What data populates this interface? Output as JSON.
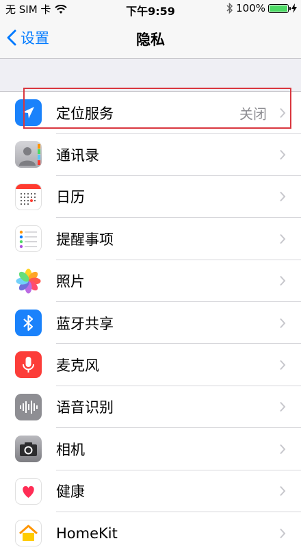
{
  "status_bar": {
    "carrier": "无 SIM 卡",
    "time": "下午9:59",
    "battery": "100%",
    "battery_level": 1.0
  },
  "nav": {
    "back_label": "设置",
    "title": "隐私"
  },
  "rows": [
    {
      "label": "定位服务",
      "value": "关闭",
      "icon": "location-arrow-icon",
      "color": "#1a82fb"
    },
    {
      "label": "通讯录",
      "value": "",
      "icon": "contacts-icon",
      "color": "#8e8e93"
    },
    {
      "label": "日历",
      "value": "",
      "icon": "calendar-icon",
      "color": "#ffffff"
    },
    {
      "label": "提醒事项",
      "value": "",
      "icon": "reminders-icon",
      "color": "#ffffff"
    },
    {
      "label": "照片",
      "value": "",
      "icon": "photos-icon",
      "color": "#ffffff"
    },
    {
      "label": "蓝牙共享",
      "value": "",
      "icon": "bluetooth-icon",
      "color": "#1a82fb"
    },
    {
      "label": "麦克风",
      "value": "",
      "icon": "microphone-icon",
      "color": "#fc3d39"
    },
    {
      "label": "语音识别",
      "value": "",
      "icon": "speech-recognition-icon",
      "color": "#8e8e93"
    },
    {
      "label": "相机",
      "value": "",
      "icon": "camera-icon",
      "color": "#8e8e93"
    },
    {
      "label": "健康",
      "value": "",
      "icon": "health-heart-icon",
      "color": "#ffffff"
    },
    {
      "label": "HomeKit",
      "value": "",
      "icon": "home-icon",
      "color": "#ffffff"
    }
  ]
}
